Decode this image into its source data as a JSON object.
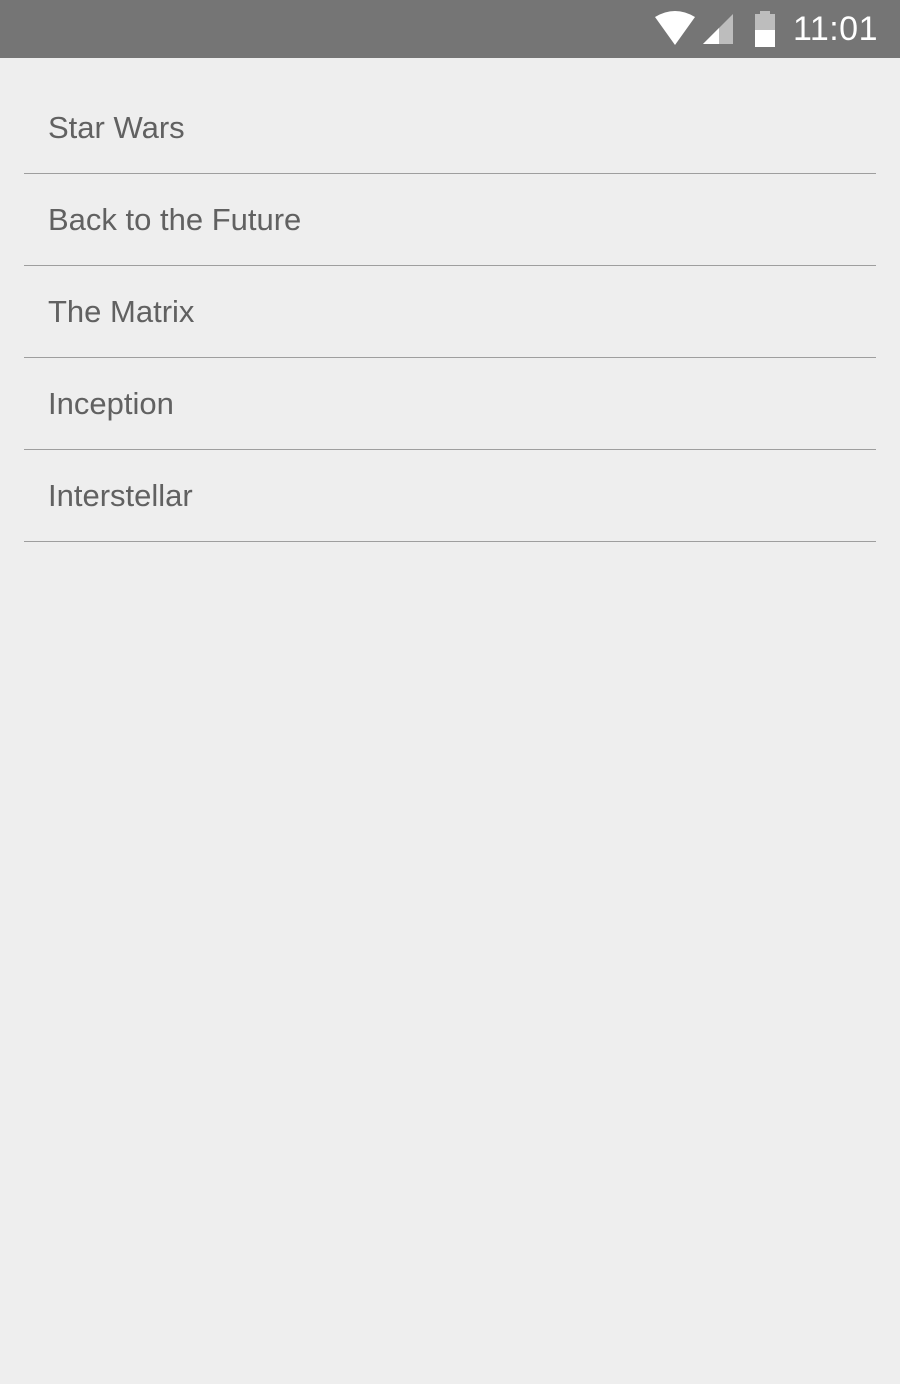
{
  "status_bar": {
    "time": "11:01",
    "icons": [
      "wifi-icon",
      "cell-signal-icon",
      "battery-icon"
    ]
  },
  "list": {
    "items": [
      {
        "label": "Star Wars"
      },
      {
        "label": "Back to the Future"
      },
      {
        "label": "The Matrix"
      },
      {
        "label": "Inception"
      },
      {
        "label": "Interstellar"
      }
    ]
  },
  "colors": {
    "status_bar_bg": "#757575",
    "background": "#eeeeee",
    "text": "#616161",
    "divider": "#9e9e9e"
  }
}
